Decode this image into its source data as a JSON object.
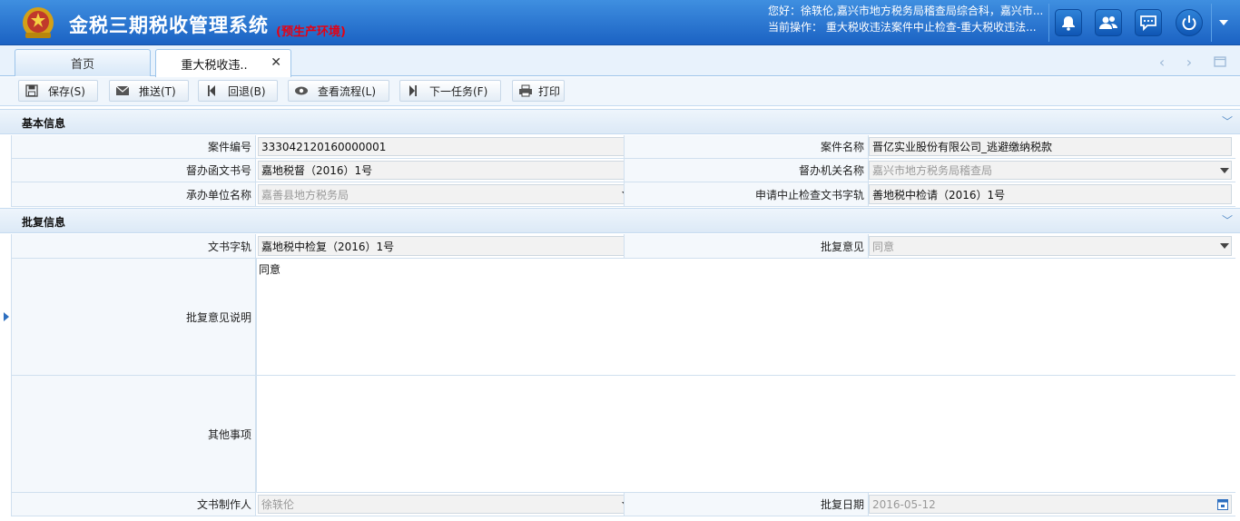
{
  "app": {
    "title": "金税三期税收管理系统",
    "env": "(预生产环境)"
  },
  "header": {
    "user_line": "您好：徐轶伦,嘉兴市地方税务局稽查局综合科，嘉兴市...",
    "op_line": "当前操作：  重大税收违法案件中止检查-重大税收违法..."
  },
  "tabs": {
    "home": "首页",
    "current": "重大税收违..",
    "close": "✕"
  },
  "toolbar": {
    "save": "保存(S)",
    "push": "推送(T)",
    "back": "回退(B)",
    "flow": "查看流程(L)",
    "next": "下一任务(F)",
    "print": "打印"
  },
  "basic": {
    "title": "基本信息",
    "case_no_label": "案件编号",
    "case_no": "333042120160000001",
    "case_name_label": "案件名称",
    "case_name": "晋亿实业股份有限公司_逃避缴纳税款",
    "doc_no_label": "督办函文书号",
    "doc_no": "嘉地税督（2016）1号",
    "org_label": "督办机关名称",
    "org": "嘉兴市地方税务局稽查局",
    "unit_label": "承办单位名称",
    "unit": "嘉善县地方税务局",
    "apply_label": "申请中止检查文书字轨",
    "apply": "善地税中检请（2016）1号"
  },
  "reply": {
    "title": "批复信息",
    "doc_label": "文书字轨",
    "doc": "嘉地税中检复（2016）1号",
    "opinion_label": "批复意见",
    "opinion": "同意",
    "desc_label": "批复意见说明",
    "desc": "同意",
    "other_label": "其他事项",
    "other": "",
    "maker_label": "文书制作人",
    "maker": "徐轶伦",
    "date_label": "批复日期",
    "date": "2016-05-12"
  }
}
